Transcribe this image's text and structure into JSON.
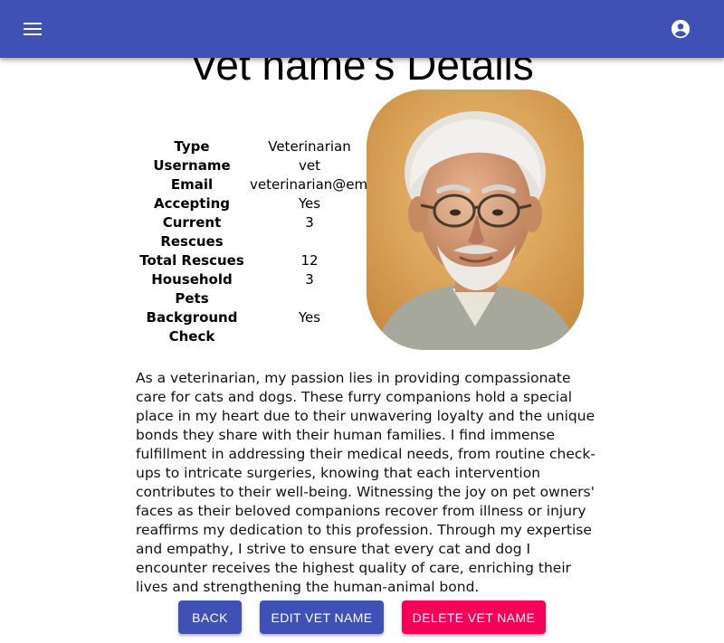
{
  "header": {
    "menu_icon": "menu-icon",
    "account_icon": "account-circle-icon",
    "bar_color": "#3f51b5"
  },
  "page": {
    "title": "Vet name's Details"
  },
  "details": [
    {
      "label": "Type",
      "value": "Veterinarian"
    },
    {
      "label": "Username",
      "value": "vet"
    },
    {
      "label": "Email",
      "value": "veterinarian@ema"
    },
    {
      "label": "Accepting",
      "value": "Yes"
    },
    {
      "label": "Current Rescues",
      "value": "3"
    },
    {
      "label": "Total Rescues",
      "value": "12"
    },
    {
      "label": "Household Pets",
      "value": "3"
    },
    {
      "label": "Background Check",
      "value": "Yes"
    }
  ],
  "bio": "As a veterinarian, my passion lies in providing compassionate care for cats and dogs. These furry companions hold a special place in my heart due to their unwavering loyalty and the unique bonds they share with their human families. I find immense fulfillment in addressing their medical needs, from routine check-ups to intricate surgeries, knowing that each intervention contributes to their well-being. Witnessing the joy on pet owners' faces as their beloved companions recover from illness or injury reaffirms my dedication to this profession. Through my expertise and empathy, I strive to ensure that every cat and dog I encounter receives the highest quality of care, enriching their lives and strengthening the human-animal bond.",
  "buttons": {
    "back": "BACK",
    "edit": "EDIT VET NAME",
    "delete": "DELETE VET NAME",
    "primary_color": "#3f51b5",
    "danger_color": "#f50057"
  }
}
